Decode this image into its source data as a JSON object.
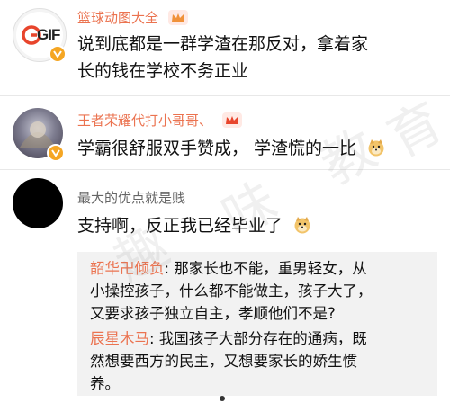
{
  "comments": [
    {
      "username": "篮球动图大全",
      "avatar_text": "GIF",
      "badge_icon": "crown-icon",
      "text_lines": [
        "说到底都是一群学渣在那反对，拿着家",
        "长的钱在学校不务正业"
      ]
    },
    {
      "username": "王者荣耀代打小哥哥、",
      "badge_icon": "crown-icon",
      "text_lines": [
        "学霸很舒服双手赞成， 学渣慌的一比"
      ],
      "emoji": "doge-emoji"
    },
    {
      "username": "最大的优点就是贱",
      "text_lines": [
        "支持啊，反正我已经毕业了"
      ],
      "emoji": "doge-emoji",
      "replies": [
        {
          "username": "韶华卍倾负",
          "lines": [
            ": 那家长也不能，重男轻女，从",
            "小操控孩子，什么都不能做主，孩子大了，",
            "又要求孩子独立自主，孝顺他们不是?"
          ]
        },
        {
          "username": "辰星木马",
          "lines": [
            ": 我国孩子大部分存在的通病，既",
            "然想要西方的民主，又想要家长的娇生惯",
            "养。"
          ]
        }
      ]
    }
  ],
  "watermark": [
    "教",
    "育",
    "趣",
    "味"
  ],
  "colors": {
    "username_orange": "#eb7350",
    "username_gray": "#666666",
    "reply_bg": "#f2f2f2"
  }
}
